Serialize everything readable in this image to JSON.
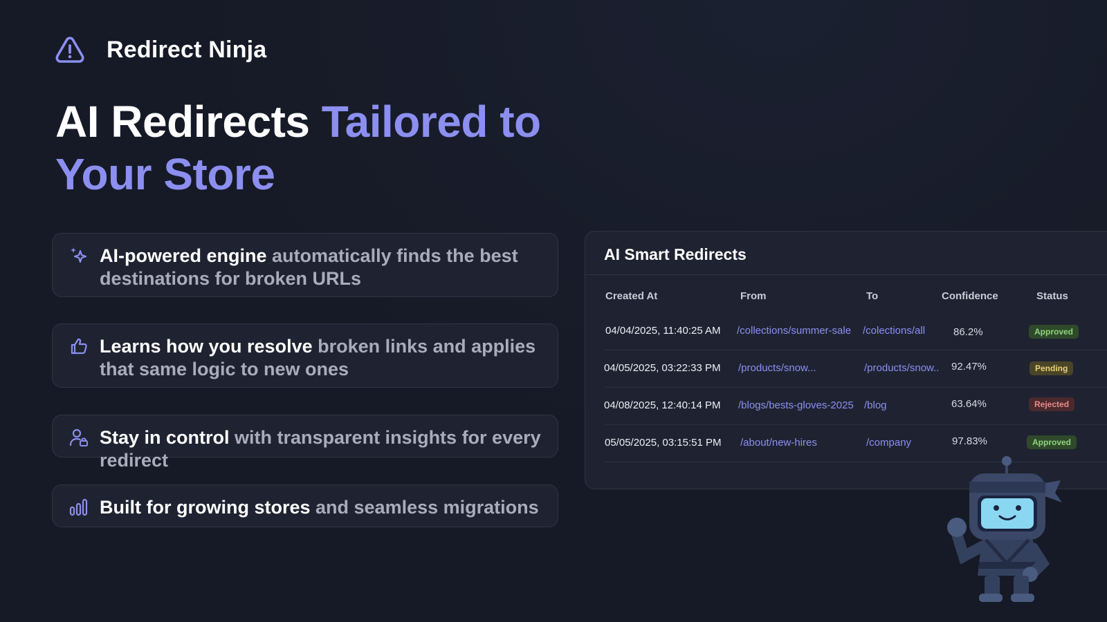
{
  "brand": {
    "name": "Redirect Ninja",
    "icon": "warning-triangle-icon"
  },
  "hero": {
    "plain": "AI Redirects ",
    "accent": "Tailored to Your Store"
  },
  "features": [
    {
      "icon": "sparkle-icon",
      "strong": "AI-powered engine",
      "rest": " automatically finds the best destinations for broken URLs"
    },
    {
      "icon": "thumbs-up-icon",
      "strong": "Learns how you resolve",
      "rest": " broken links and applies that same logic to new ones"
    },
    {
      "icon": "user-lock-icon",
      "strong": "Stay in control",
      "rest": " with transparent insights for every redirect"
    },
    {
      "icon": "bar-chart-icon",
      "strong": "Built for growing stores",
      "rest": " and seamless migrations"
    }
  ],
  "table": {
    "title": "AI Smart Redirects",
    "columns": [
      "Created At",
      "From",
      "To",
      "Confidence",
      "Status"
    ],
    "rows": [
      {
        "created": "04/04/2025, 11:40:25 AM",
        "from": "/collections/summer-sale",
        "to": "/colections/all",
        "confidence": "86.2%",
        "status": "Approved"
      },
      {
        "created": "04/05/2025, 03:22:33 PM",
        "from": "/products/snow...",
        "to": "/products/snow..",
        "confidence": "92.47%",
        "status": "Pending"
      },
      {
        "created": "04/08/2025, 12:40:14 PM",
        "from": "/blogs/bests-gloves-2025",
        "to": "/blog",
        "confidence": "63.64%",
        "status": "Rejected"
      },
      {
        "created": "05/05/2025, 03:15:51 PM",
        "from": "/about/new-hires",
        "to": "/company",
        "confidence": "97.83%",
        "status": "Approved"
      }
    ]
  },
  "colors": {
    "background": "#161a26",
    "accent": "#8c8ff0",
    "card": "#1f2331",
    "approved": "#8fd47c",
    "pending": "#e8d27a",
    "rejected": "#e88a8a"
  },
  "mascot": {
    "icon": "ninja-robot-mascot"
  }
}
